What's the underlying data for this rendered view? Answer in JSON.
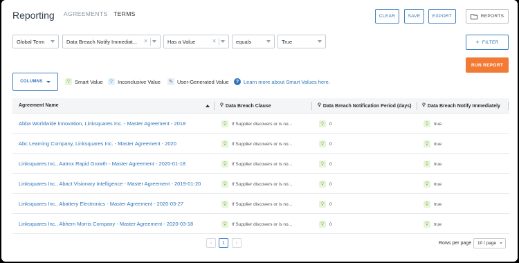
{
  "header": {
    "title": "Reporting",
    "tabs": [
      {
        "label": "AGREEMENTS",
        "active": false
      },
      {
        "label": "TERMS",
        "active": true
      }
    ],
    "buttons": {
      "clear": "CLEAR",
      "save": "SAVE",
      "export": "EXPORT",
      "reports": "REPORTS"
    }
  },
  "filters": {
    "scope": "Global Term",
    "field": "Data Breach Notify Immediat...",
    "condition": "Has a Value",
    "operator": "equals",
    "value": "True",
    "filter_button": "FILTER",
    "run_button": "RUN REPORT"
  },
  "toolbar": {
    "columns_button": "COLUMNS",
    "legend": {
      "smart": "Smart Value",
      "inconclusive": "Inconclusive Value",
      "user": "User-Generated Value",
      "learn_more": "Learn more about Smart Values here."
    }
  },
  "table": {
    "columns": [
      "Agreement Name",
      "Data Breach Clause",
      "Data Breach Notification Period (days)",
      "Data Breach Notify Immediately"
    ],
    "sort": {
      "column": "Agreement Name",
      "direction": "ascending"
    },
    "rows": [
      {
        "name": "Abba Worldwide Innovation, Linksquares Inc. - Master Agreement - 2018",
        "clause": "If Supplier discovers or is no...",
        "period": "0",
        "notify": "true"
      },
      {
        "name": "Abc Learning Company, Linksquares Inc. - Master Agreement - 2020",
        "clause": "If Supplier discovers or is no...",
        "period": "0",
        "notify": "true"
      },
      {
        "name": "Linksquares Inc., Aatrox Rapid Growth - Master Agreement - 2020-01-18",
        "clause": "If Supplier discovers or is no...",
        "period": "0",
        "notify": "true"
      },
      {
        "name": "Linksquares Inc., Abact Visionary Intelligence - Master Agreement - 2019-01-20",
        "clause": "If Supplier discovers or is no...",
        "period": "0",
        "notify": "true"
      },
      {
        "name": "Linksquares Inc., Abattery Electronics - Master Agreement - 2020-03-27",
        "clause": "If Supplier discovers or is no...",
        "period": "0",
        "notify": "true"
      },
      {
        "name": "Linksquares Inc., Abhem Morris Company - Master Agreement - 2020-03-18",
        "clause": "If Supplier discovers or is no...",
        "period": "0",
        "notify": "true"
      }
    ]
  },
  "pagination": {
    "current_page": "1",
    "prev": "‹",
    "next": "›",
    "rows_per_page_label": "Rows per page",
    "rows_per_page_value": "10 / page"
  },
  "icons": {
    "smart": "lightbulb-icon",
    "inconclusive": "lightbulb-outline-icon",
    "user": "pencil-icon",
    "info": "question-circle-icon",
    "reports": "folder-icon"
  },
  "colors": {
    "accent": "#2f74b9",
    "run_report": "#f27a34"
  }
}
